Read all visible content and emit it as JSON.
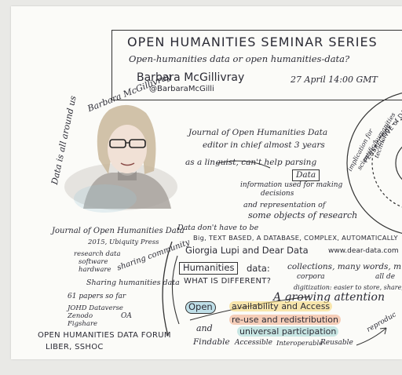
{
  "header": {
    "series_title": "OPEN HUMANITIES SEMINAR SERIES",
    "subtitle": "Open-humanities data or open humanities-data?",
    "speaker": "Barbara McGillivray",
    "handle": "@BarbaraMcGilli",
    "date": "27 April 14:00 GMT"
  },
  "portrait": {
    "name_arc": "Barbara McGillivray",
    "side_note": "Data is all around us"
  },
  "left": {
    "journal": "Journal of Open Humanities Data",
    "journal_meta": "2015, Ubiquity Press",
    "topics": [
      "research data",
      "software",
      "hardware"
    ],
    "sharing_community": "sharing community",
    "sharing_data": "Sharing humanities data",
    "papers": "61 papers so far",
    "repos": [
      "JOHD Dataverse",
      "Zenodo",
      "Figshare"
    ],
    "oa": "OA",
    "forum": "OPEN HUMANITIES DATA FORUM",
    "forum_sub": "LIBER, SSHOC"
  },
  "center": {
    "editor_line1": "Journal of Open Humanities Data",
    "editor_line2": "editor in chief almost 3 years",
    "linguist": "as a linguist, can't help parsing",
    "data_word": "Data",
    "info1": "information used for making",
    "info2": "decisions",
    "repr1": "and representation of",
    "repr2": "some objects of research",
    "dont": "Data don't have to be",
    "types": "Big, TEXT BASED, A DATABASE, COMPLEX, AUTOMATICALLY",
    "lupi": "Giorgia Lupi and Dear Data",
    "url": "www.dear-data.com",
    "humanities": "Humanities",
    "data_colon": "data:",
    "collections": "collections, many words, m",
    "corpora": "corpora",
    "all_de": "all de",
    "different": "WHAT IS DIFFERENT?",
    "digitization": "digitization: easier to store, share, co",
    "growing": "A growing attention",
    "open": "Open",
    "availability": "availability and Access",
    "reuse": "re-use and redistribution",
    "universal": "universal participation",
    "and": "and",
    "fair": [
      "Findable",
      "Accessible",
      "Interoperable",
      "Reusable"
    ],
    "reproduc": "reproduc"
  },
  "right_circle": {
    "implication": "implication for",
    "scientific": "scientific/humanities",
    "perspective": "PERSPECTIVE of DATA",
    "tech": "technology"
  }
}
